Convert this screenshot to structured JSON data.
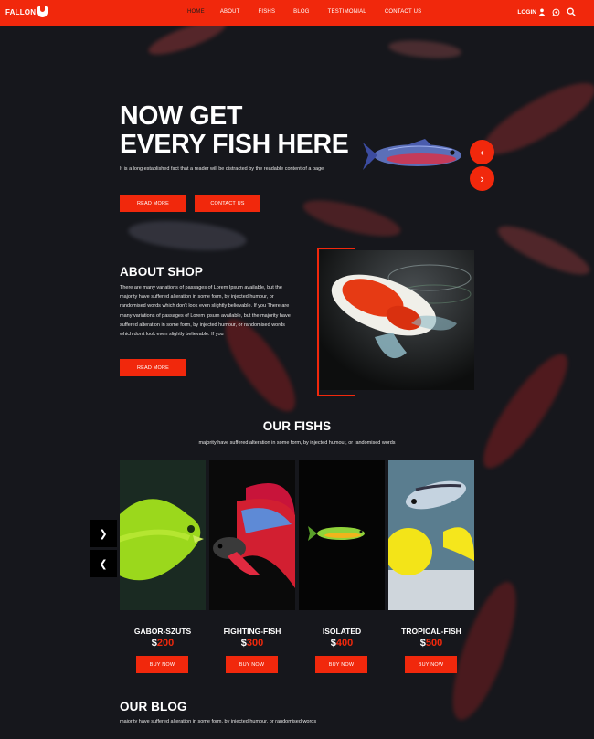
{
  "brand": {
    "name": "FALLON"
  },
  "nav": {
    "items": [
      {
        "label": "HOME",
        "active": true
      },
      {
        "label": "ABOUT"
      },
      {
        "label": "FISHS"
      },
      {
        "label": "BLOG"
      },
      {
        "label": "TESTIMONIAL"
      },
      {
        "label": "CONTACT US"
      }
    ],
    "login_label": "LOGIN",
    "icons": [
      "user-icon",
      "whatsapp-icon",
      "search-icon"
    ]
  },
  "hero": {
    "title_line1": "NOW GET",
    "title_line2": "EVERY FISH HERE",
    "text": "It is a long established fact that a reader will be distracted by the readable content of a page",
    "read_more": "READ MORE",
    "contact_us": "CONTACT US",
    "prev_icon": "chevron-left-icon",
    "next_icon": "chevron-right-icon"
  },
  "about": {
    "title": "ABOUT SHOP",
    "text": "There are many variations of passages of Lorem Ipsum available, but the majority have suffered alteration in some form, by injected humour, or randomised words which don't look even slightly believable. If you There are many variations of passages of Lorem Ipsum available, but the majority have suffered alteration in some form, by injected humour, or randomised words which don't look even slightly believable. If you",
    "read_more": "READ MORE"
  },
  "fishs": {
    "title": "OUR FISHS",
    "subtitle": "majority have suffered alteration in some form, by injected humour, or randomised words",
    "prev": "❯",
    "next": "❮",
    "items": [
      {
        "name": "GABOR-SZUTS",
        "currency": "$",
        "price": "200",
        "buy": "BUY NOW"
      },
      {
        "name": "FIGHTING-FISH",
        "currency": "$",
        "price": "300",
        "buy": "BUY NOW"
      },
      {
        "name": "ISOLATED",
        "currency": "$",
        "price": "400",
        "buy": "BUY NOW"
      },
      {
        "name": "TROPICAL-FISH",
        "currency": "$",
        "price": "500",
        "buy": "BUY NOW"
      }
    ]
  },
  "blog": {
    "title": "OUR BLOG",
    "subtitle": "majority have suffered alteration in some form, by injected humour, or randomised words"
  },
  "colors": {
    "accent": "#f1280c",
    "background": "#16171c"
  }
}
